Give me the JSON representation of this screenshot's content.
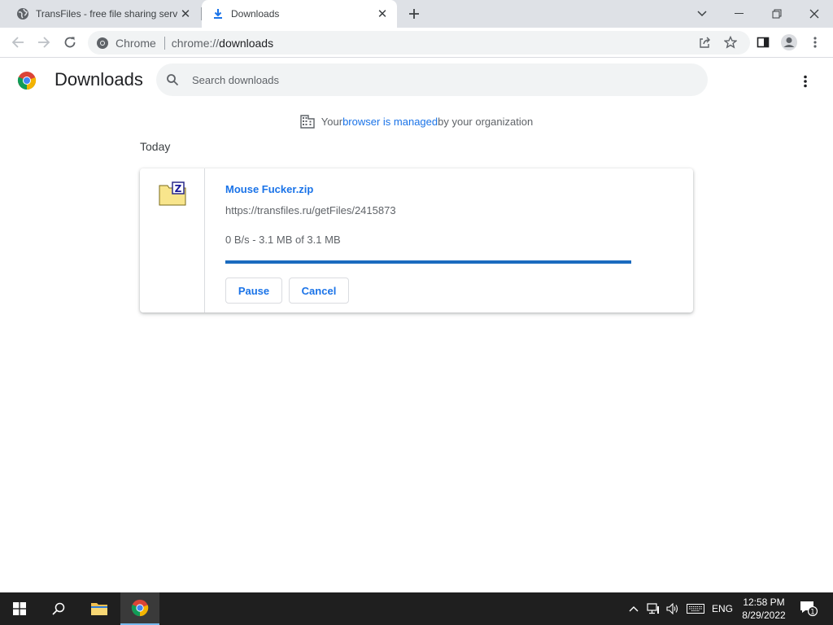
{
  "tabs": [
    {
      "title": "TransFiles - free file sharing servic",
      "icon": "globe-icon",
      "active": false
    },
    {
      "title": "Downloads",
      "icon": "download-icon",
      "active": true
    }
  ],
  "window_controls": [
    "chevron-down-icon",
    "minimize-icon",
    "restore-icon",
    "close-icon"
  ],
  "omnibox": {
    "chip_label": "Chrome",
    "url_prefix": "chrome://",
    "url_host": "downloads"
  },
  "page": {
    "title": "Downloads",
    "search_placeholder": "Search downloads",
    "managed": {
      "pre": "Your ",
      "link": "browser is managed",
      "post": " by your organization"
    },
    "date_group": "Today"
  },
  "download": {
    "filename": "Mouse Fucker.zip",
    "url": "https://transfiles.ru/getFiles/2415873",
    "status": "0 B/s - 3.1 MB of 3.1 MB",
    "progress_percent": 100,
    "pause_label": "Pause",
    "cancel_label": "Cancel"
  },
  "taskbar": {
    "language": "ENG",
    "time": "12:58 PM",
    "date": "8/29/2022",
    "notification_count": "1"
  },
  "colors": {
    "accent": "#1a73e8",
    "progress": "#1b6bbf",
    "tabstrip": "#dee1e6",
    "taskbar": "#1f1f1f"
  }
}
